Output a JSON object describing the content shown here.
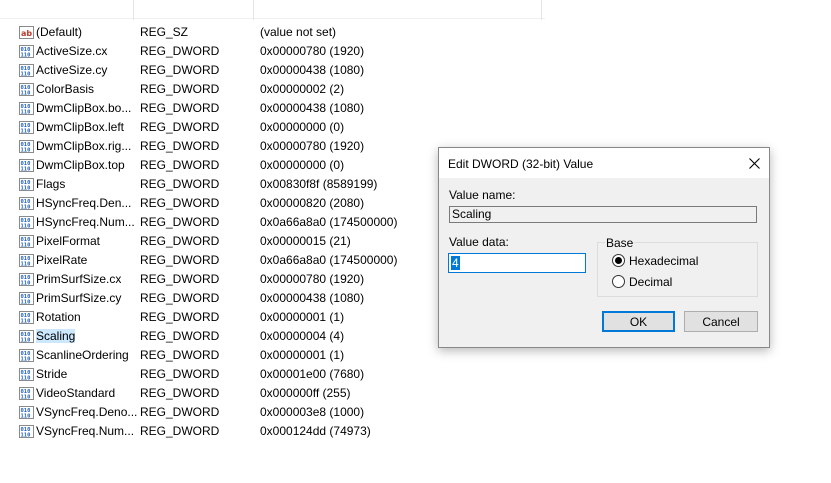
{
  "registry": {
    "rows": [
      {
        "icon": "string-value-icon",
        "name": "(Default)",
        "type": "REG_SZ",
        "data": "(value not set)"
      },
      {
        "icon": "binary-value-icon",
        "name": "ActiveSize.cx",
        "type": "REG_DWORD",
        "data": "0x00000780 (1920)"
      },
      {
        "icon": "binary-value-icon",
        "name": "ActiveSize.cy",
        "type": "REG_DWORD",
        "data": "0x00000438 (1080)"
      },
      {
        "icon": "binary-value-icon",
        "name": "ColorBasis",
        "type": "REG_DWORD",
        "data": "0x00000002 (2)"
      },
      {
        "icon": "binary-value-icon",
        "name": "DwmClipBox.bo...",
        "type": "REG_DWORD",
        "data": "0x00000438 (1080)"
      },
      {
        "icon": "binary-value-icon",
        "name": "DwmClipBox.left",
        "type": "REG_DWORD",
        "data": "0x00000000 (0)"
      },
      {
        "icon": "binary-value-icon",
        "name": "DwmClipBox.rig...",
        "type": "REG_DWORD",
        "data": "0x00000780 (1920)"
      },
      {
        "icon": "binary-value-icon",
        "name": "DwmClipBox.top",
        "type": "REG_DWORD",
        "data": "0x00000000 (0)"
      },
      {
        "icon": "binary-value-icon",
        "name": "Flags",
        "type": "REG_DWORD",
        "data": "0x00830f8f (8589199)"
      },
      {
        "icon": "binary-value-icon",
        "name": "HSyncFreq.Den...",
        "type": "REG_DWORD",
        "data": "0x00000820 (2080)"
      },
      {
        "icon": "binary-value-icon",
        "name": "HSyncFreq.Num...",
        "type": "REG_DWORD",
        "data": "0x0a66a8a0 (174500000)"
      },
      {
        "icon": "binary-value-icon",
        "name": "PixelFormat",
        "type": "REG_DWORD",
        "data": "0x00000015 (21)"
      },
      {
        "icon": "binary-value-icon",
        "name": "PixelRate",
        "type": "REG_DWORD",
        "data": "0x0a66a8a0 (174500000)"
      },
      {
        "icon": "binary-value-icon",
        "name": "PrimSurfSize.cx",
        "type": "REG_DWORD",
        "data": "0x00000780 (1920)"
      },
      {
        "icon": "binary-value-icon",
        "name": "PrimSurfSize.cy",
        "type": "REG_DWORD",
        "data": "0x00000438 (1080)"
      },
      {
        "icon": "binary-value-icon",
        "name": "Rotation",
        "type": "REG_DWORD",
        "data": "0x00000001 (1)"
      },
      {
        "icon": "binary-value-icon",
        "name": "Scaling",
        "type": "REG_DWORD",
        "data": "0x00000004 (4)",
        "selected": true
      },
      {
        "icon": "binary-value-icon",
        "name": "ScanlineOrdering",
        "type": "REG_DWORD",
        "data": "0x00000001 (1)"
      },
      {
        "icon": "binary-value-icon",
        "name": "Stride",
        "type": "REG_DWORD",
        "data": "0x00001e00 (7680)"
      },
      {
        "icon": "binary-value-icon",
        "name": "VideoStandard",
        "type": "REG_DWORD",
        "data": "0x000000ff (255)"
      },
      {
        "icon": "binary-value-icon",
        "name": "VSyncFreq.Deno...",
        "type": "REG_DWORD",
        "data": "0x000003e8 (1000)"
      },
      {
        "icon": "binary-value-icon",
        "name": "VSyncFreq.Num...",
        "type": "REG_DWORD",
        "data": "0x000124dd (74973)"
      }
    ]
  },
  "dialog": {
    "title": "Edit DWORD (32-bit) Value",
    "value_name_label": "Value name:",
    "value_name": "Scaling",
    "value_data_label": "Value data:",
    "value_data": "4",
    "base_label": "Base",
    "base_options": [
      {
        "label": "Hexadecimal",
        "checked": true
      },
      {
        "label": "Decimal",
        "checked": false
      }
    ],
    "ok_label": "OK",
    "cancel_label": "Cancel"
  },
  "colors": {
    "accent": "#0078d7",
    "selection": "#cce8ff",
    "icon_red": "#c0392b",
    "icon_blue": "#1f5fbf"
  }
}
